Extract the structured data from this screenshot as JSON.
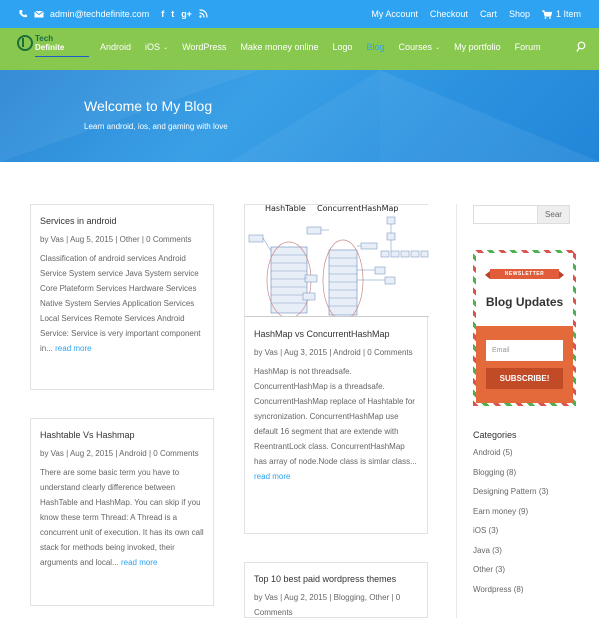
{
  "topbar": {
    "email": "admin@techdefinite.com",
    "social": [
      "f",
      "t",
      "g+",
      "rss"
    ],
    "links": [
      "My Account",
      "Checkout",
      "Cart",
      "Shop"
    ],
    "cart_count": "1 Item"
  },
  "logo": {
    "line1": "Tech",
    "line2": "Definite"
  },
  "nav": {
    "items": [
      {
        "label": "Android"
      },
      {
        "label": "iOS",
        "dropdown": true
      },
      {
        "label": "WordPress"
      },
      {
        "label": "Make money online"
      },
      {
        "label": "Logo"
      },
      {
        "label": "Blog",
        "active": true
      },
      {
        "label": "Courses",
        "dropdown": true
      },
      {
        "label": "My portfolio"
      },
      {
        "label": "Forum"
      }
    ]
  },
  "hero": {
    "title": "Welcome to My Blog",
    "subtitle": "Learn android, ios, and gaming with love"
  },
  "posts": [
    {
      "title": "Services in android",
      "meta": "by Vas | Aug 5, 2015 | Other | 0 Comments",
      "excerpt": "Classification of  android services Android Service System service Java System service Core Plateform Services Hardware Services Native System Servies Application Services Local Services Remote Services Android Service: Service is very important component in...",
      "more": "read more"
    },
    {
      "title": "Hashtable Vs Hashmap",
      "meta": "by Vas | Aug 2, 2015 | Android | 0 Comments",
      "excerpt": "There are some basic term you have to understand clearly difference between HashTable and HashMap. You can skip if  you know these term Thread: A Thread is a concurrent unit of execution. It has its own call stack for methods being invoked, their arguments and local...",
      "more": "read more"
    },
    {
      "title": "HashMap vs ConcurrentHashMap",
      "meta": "by Vas | Aug 3, 2015 | Android | 0 Comments",
      "excerpt": "HashMap is not threadsafe. ConcurrentHashMap is a threadsafe. ConcurrentHashMap replace of Hashtable for syncronization. ConcurrentHashMap use default 16 segment that are extende with ReentrantLock class. ConcurrentHashMap has array of node.Node class is simlar class...",
      "more": "read more",
      "thumb_labels": [
        "HashTable",
        "ConcurrentHashMap"
      ]
    },
    {
      "title": "Top 10 best paid wordpress themes",
      "meta": "by Vas | Aug 2, 2015 | Blogging, Other | 0 Comments"
    }
  ],
  "sidebar": {
    "search_button": "Sear",
    "newsletter": {
      "ribbon": "NEWSLETTER",
      "heading": "Blog Updates",
      "email_placeholder": "Email",
      "subscribe": "SUBSCRIBE!"
    },
    "categories_heading": "Categories",
    "categories": [
      "Android (5)",
      "Blogging (8)",
      "Designing Pattern (3)",
      "Earn money (9)",
      "iOS (3)",
      "Java (3)",
      "Other (3)",
      "Wordpress (8)"
    ]
  },
  "colors": {
    "topbar": "#2ea3f2",
    "nav": "#89c84e",
    "accent": "#2ea3f2",
    "newsletter_orange": "#e46a3c"
  }
}
